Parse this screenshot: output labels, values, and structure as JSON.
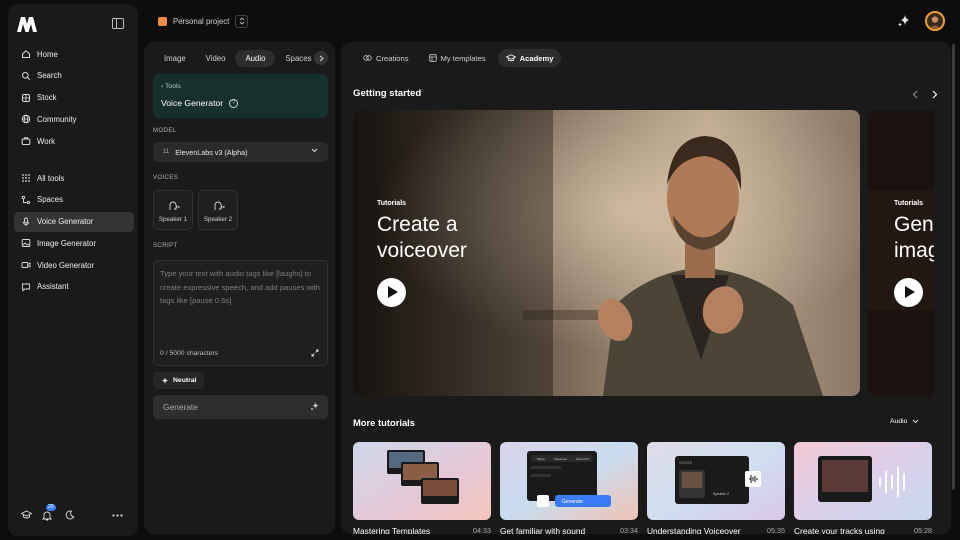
{
  "sidebar": {
    "items": [
      {
        "label": "Home",
        "icon": "home-icon"
      },
      {
        "label": "Search",
        "icon": "search-icon"
      },
      {
        "label": "Stock",
        "icon": "stock-icon"
      },
      {
        "label": "Community",
        "icon": "globe-icon"
      },
      {
        "label": "Work",
        "icon": "briefcase-icon"
      }
    ],
    "tools": [
      {
        "label": "All tools",
        "icon": "grid-icon"
      },
      {
        "label": "Spaces",
        "icon": "spaces-icon"
      },
      {
        "label": "Voice Generator",
        "icon": "microphone-icon",
        "active": true
      },
      {
        "label": "Image Generator",
        "icon": "image-icon"
      },
      {
        "label": "Video Generator",
        "icon": "video-icon"
      },
      {
        "label": "Assistant",
        "icon": "chat-icon"
      }
    ],
    "notification_count": "20"
  },
  "topbar": {
    "project": "Personal project",
    "project_color": "#f08a4b"
  },
  "panel": {
    "tabs": [
      "Image",
      "Video",
      "Audio",
      "Spaces"
    ],
    "active_tab": "Audio",
    "back_label": "Tools",
    "title": "Voice Generator",
    "model_label": "MODEL",
    "model_value": "ElevenLabs v3 (Alpha)",
    "model_icon_text": "11",
    "voices_label": "VOICES",
    "voices": [
      "Speaker 1",
      "Speaker 2"
    ],
    "script_label": "SCRIPT",
    "script_placeholder": "Type your text with audio tags like [laughs] to create expressive speech, and add pauses with tags like [pause 0.5s]",
    "char_count": "0 / 5000 characters",
    "tone": "Neutral",
    "generate": "Generate"
  },
  "main": {
    "tabs": [
      {
        "label": "Creations",
        "icon": "creations-icon"
      },
      {
        "label": "My templates",
        "icon": "templates-icon"
      },
      {
        "label": "Academy",
        "icon": "academy-icon",
        "active": true
      }
    ],
    "getting_started": "Getting started",
    "hero": {
      "tag": "Tutorials",
      "title": "Create a voiceover"
    },
    "hero_next": {
      "tag": "Tutorials",
      "title": "Gen imag"
    },
    "more_tutorials": "More tutorials",
    "filter": "Audio",
    "cards": [
      {
        "title": "Mastering Templates",
        "duration": "04:33"
      },
      {
        "title": "Get familiar with sound",
        "duration": "03:34"
      },
      {
        "title": "Understanding Voiceover",
        "duration": "05:35"
      },
      {
        "title": "Create your tracks using",
        "duration": "05:28"
      }
    ],
    "card_mockups": {
      "generate": "Generate",
      "voices": "VOICES",
      "speaker_2": "Speaker 2",
      "tabs": [
        "Music",
        "Voiceover",
        "Sound FX"
      ]
    }
  }
}
